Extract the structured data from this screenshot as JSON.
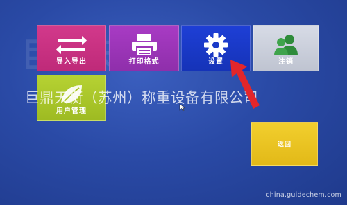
{
  "tiles": {
    "import_export": {
      "label": "导入导出",
      "icon": "swap-arrows-icon",
      "color": "#c92f82"
    },
    "print_format": {
      "label": "打印格式",
      "icon": "printer-icon",
      "color": "#9b35b8"
    },
    "settings": {
      "label": "设置",
      "icon": "gear-icon",
      "color": "#1a3ac8"
    },
    "logout": {
      "label": "注销",
      "icon": "users-icon",
      "color": "#cdd1dd"
    },
    "user_manage": {
      "label": "用户管理",
      "icon": "leaf-icon",
      "color": "#aac62a"
    },
    "back": {
      "label": "返回",
      "color": "#ebc423"
    }
  },
  "overlay": {
    "company_text": "巨鼎天衡（苏州）称重设备有限公司",
    "watermark_bg": "巨鼎天衡",
    "corner_watermark": "china.guidechem.com"
  },
  "annotations": {
    "arrow_color": "#e3262b"
  }
}
